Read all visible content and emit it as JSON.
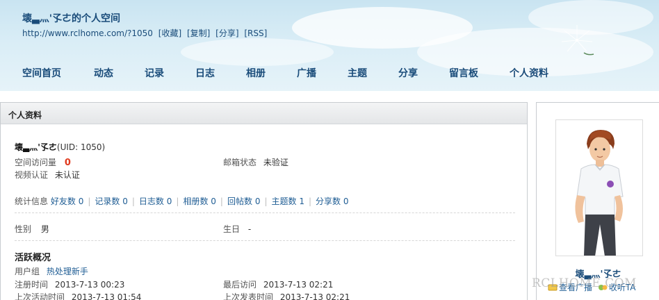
{
  "header": {
    "title": "壊▃灬'孓ㄜ的个人空间",
    "url": "http://www.rclhome.com/?1050",
    "links": [
      "[收藏]",
      "[复制]",
      "[分享]",
      "[RSS]"
    ]
  },
  "nav": [
    "空间首页",
    "动态",
    "记录",
    "日志",
    "相册",
    "广播",
    "主题",
    "分享",
    "留言板",
    "个人资料"
  ],
  "main": {
    "panel_title": "个人资料",
    "username": "壊▃灬'孓ㄜ",
    "uid": "(UID: 1050)",
    "visits_label": "空间访问量",
    "visits_value": "0",
    "email_label": "邮箱状态",
    "email_value": "未验证",
    "video_label": "视频认证",
    "video_value": "未认证",
    "stats_label": "统计信息",
    "stats": [
      {
        "label": "好友数",
        "value": "0"
      },
      {
        "label": "记录数",
        "value": "0"
      },
      {
        "label": "日志数",
        "value": "0"
      },
      {
        "label": "相册数",
        "value": "0"
      },
      {
        "label": "回帖数",
        "value": "0"
      },
      {
        "label": "主题数",
        "value": "1"
      },
      {
        "label": "分享数",
        "value": "0"
      }
    ],
    "gender_label": "性别",
    "gender_value": "男",
    "birthday_label": "生日",
    "birthday_value": "-",
    "activity_title": "活跃概况",
    "group_label": "用户组",
    "group_value": "热处理新手",
    "register_label": "注册时间",
    "register_value": "2013-7-13 00:23",
    "last_visit_label": "最后访问",
    "last_visit_value": "2013-7-13 02:21",
    "last_active_label": "上次活动时间",
    "last_active_value": "2013-7-13 01:54",
    "last_post_label": "上次发表时间",
    "last_post_value": "2013-7-13 02:21"
  },
  "sidebar": {
    "name": "壊▃灬'孓ㄜ",
    "view_broadcast": "查看广播",
    "follow": "收听TA"
  },
  "watermark": "RCLHOME.COM"
}
